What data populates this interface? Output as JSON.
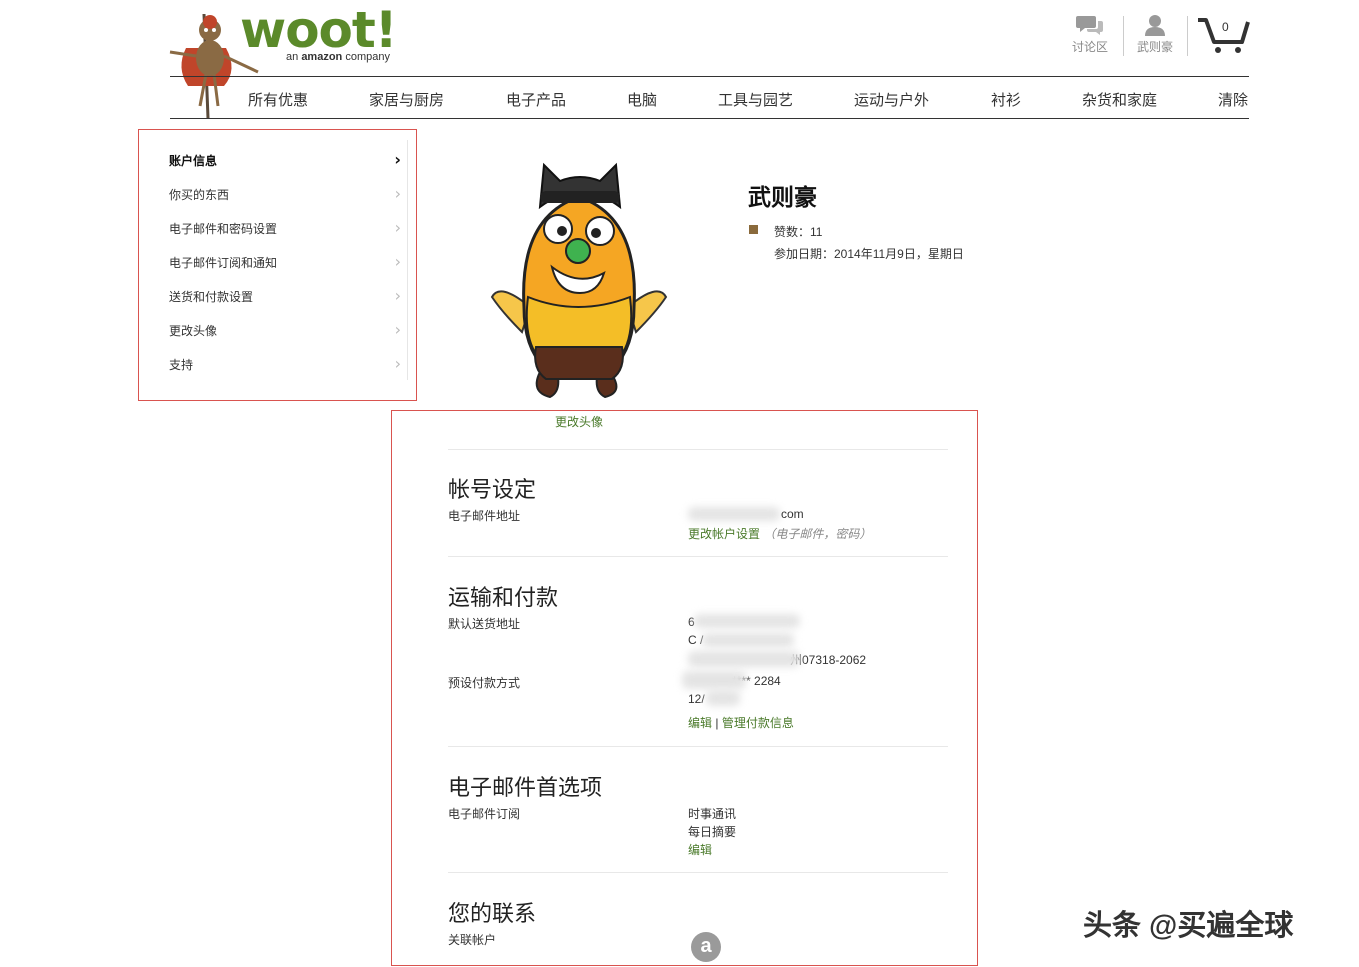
{
  "header": {
    "logo_text": "woot!",
    "logo_tagline_prefix": "an",
    "logo_tagline_brand": "amazon",
    "logo_tagline_suffix": "company",
    "forum_label": "讨论区",
    "user_label": "武则豪",
    "cart_count": "0"
  },
  "nav": {
    "items": [
      "所有优惠",
      "家居与厨房",
      "电子产品",
      "电脑",
      "工具与园艺",
      "运动与户外",
      "衬衫",
      "杂货和家庭",
      "清除"
    ]
  },
  "sidebar": {
    "items": [
      {
        "label": "账户信息",
        "active": true
      },
      {
        "label": "你买的东西"
      },
      {
        "label": "电子邮件和密码设置"
      },
      {
        "label": "电子邮件订阅和通知"
      },
      {
        "label": "送货和付款设置"
      },
      {
        "label": "更改头像"
      },
      {
        "label": "支持"
      }
    ]
  },
  "profile": {
    "name": "武则豪",
    "thumbs": "赞数：11",
    "joined": "参加日期：2014年11月9日，星期日",
    "change_avatar": "更改头像"
  },
  "account": {
    "title": "帐号设定",
    "email_label": "电子邮件地址",
    "email_value": "com",
    "change_settings_link": "更改帐户设置",
    "change_settings_note": "（电子邮件，密码）"
  },
  "shipping": {
    "title": "运输和付款",
    "address_label": "默认送货地址",
    "address_lines": [
      "6",
      "C /",
      "州07318-2062"
    ],
    "payment_label": "预设付款方式",
    "payment_lines": [
      "**** 2284",
      "12/"
    ],
    "edit_link": "编辑",
    "link_separator": "|",
    "manage_link": "管理付款信息"
  },
  "email_prefs": {
    "title": "电子邮件首选项",
    "subs_label": "电子邮件订阅",
    "subs_values": [
      "时事通讯",
      "每日摘要"
    ],
    "edit_link": "编辑"
  },
  "contacts": {
    "title": "您的联系",
    "linked_label": "关联帐户",
    "amazon_icon": "a"
  },
  "watermark": "头条 @买遍全球",
  "colors": {
    "brand_green": "#5b8a2a",
    "link_green": "#4a7a2a",
    "highlight_red": "#d9534f",
    "thumb_brown": "#8a6a3c"
  }
}
